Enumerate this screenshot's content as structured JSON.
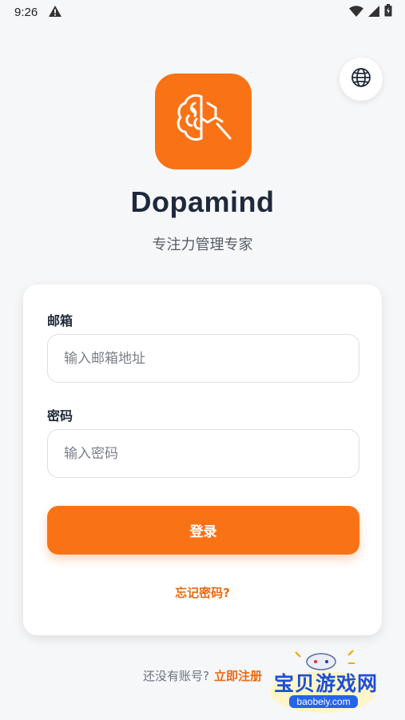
{
  "status_bar": {
    "time": "9:26",
    "icons": [
      "alert-icon",
      "wifi-icon",
      "signal-icon",
      "battery-icon"
    ]
  },
  "language_button": {
    "icon": "globe-icon"
  },
  "logo": {
    "icon": "brain-search-icon",
    "color": "#f97316"
  },
  "app": {
    "name": "Dopamind",
    "tagline": "专注力管理专家"
  },
  "login_form": {
    "email_label": "邮箱",
    "email_placeholder": "输入邮箱地址",
    "password_label": "密码",
    "password_placeholder": "输入密码",
    "login_button": "登录",
    "forgot_password": "忘记密码?"
  },
  "footer": {
    "prompt": "还没有账号?",
    "register_link": "立即注册"
  },
  "watermark": {
    "title": "宝贝游戏网",
    "url": "baobeiy.com"
  },
  "colors": {
    "accent": "#f97316",
    "background": "#f6f7f9",
    "title": "#1e293b"
  }
}
